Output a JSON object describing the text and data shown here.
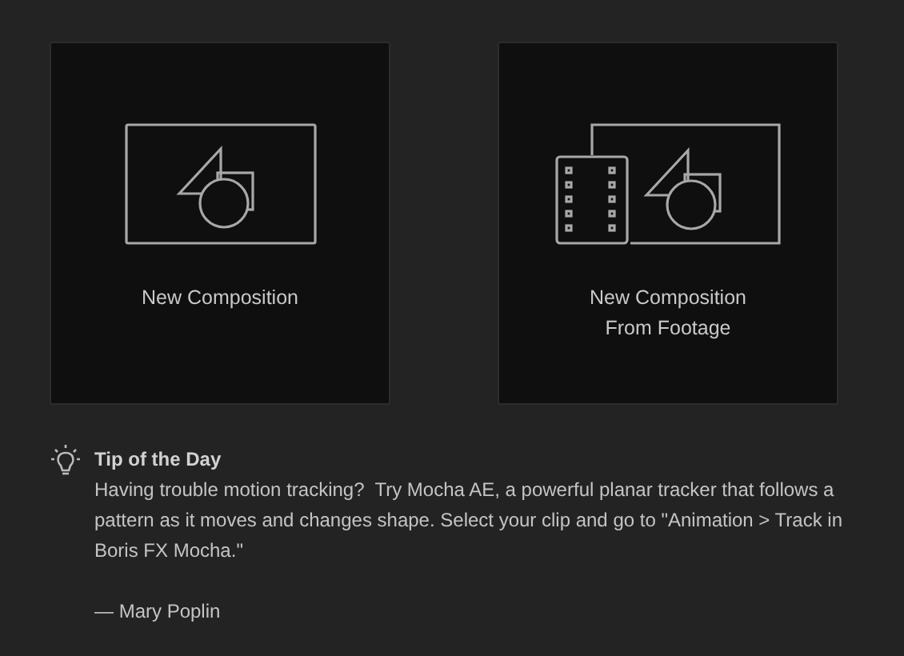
{
  "cards": [
    {
      "kind": "composition",
      "lines": [
        "New Composition"
      ]
    },
    {
      "kind": "footage",
      "lines": [
        "New Composition",
        "From Footage"
      ]
    }
  ],
  "tip": {
    "title": "Tip of the Day",
    "text": "Having trouble motion tracking?  Try Mocha AE, a powerful planar tracker that follows a pattern as it moves and changes shape. Select your clip and go to \"Animation > Track in Boris FX Mocha.\"",
    "author": "— Mary Poplin"
  }
}
